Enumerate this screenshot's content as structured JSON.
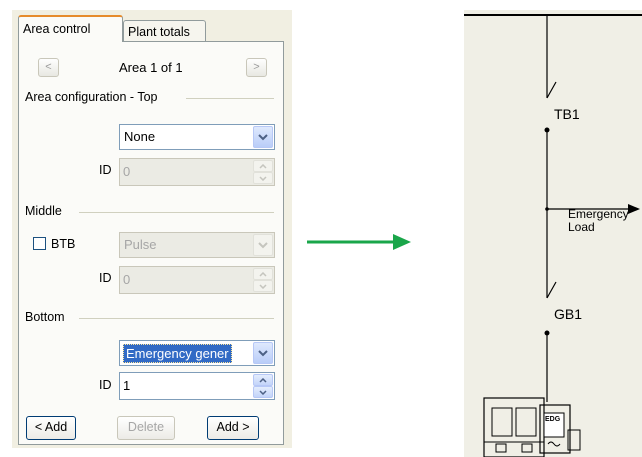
{
  "tabs": [
    {
      "label": "Area control",
      "active": true
    },
    {
      "label": "Plant totals",
      "active": false
    }
  ],
  "nav": {
    "prev_label": "<",
    "next_label": ">",
    "title": "Area 1 of 1"
  },
  "top_section": {
    "title": "Area configuration - Top",
    "selected": "None",
    "id_label": "ID",
    "id_value": "0"
  },
  "middle_section": {
    "title": "Middle",
    "checkbox_label": "BTB",
    "checkbox_checked": false,
    "selected": "Pulse",
    "id_label": "ID",
    "id_value": "0"
  },
  "bottom_section": {
    "title": "Bottom",
    "selected": "Emergency gener",
    "id_label": "ID",
    "id_value": "1"
  },
  "buttons": {
    "add_left": "< Add",
    "delete": "Delete",
    "add_right": "Add >"
  },
  "diagram": {
    "breaker_top": "TB1",
    "load_label_line1": "Emergency",
    "load_label_line2": "Load",
    "breaker_bottom": "GB1",
    "generator_label": "EDG"
  },
  "colors": {
    "arrow": "#1aa64a",
    "selection": "#316ac5",
    "tab_accent": "#e68b2c"
  }
}
